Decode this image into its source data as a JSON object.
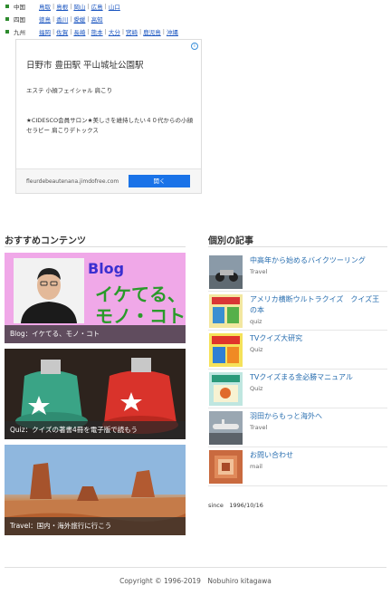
{
  "regions": [
    {
      "name": "中国",
      "links": [
        "鳥取",
        "島根",
        "岡山",
        "広島",
        "山口"
      ]
    },
    {
      "name": "四国",
      "links": [
        "徳島",
        "香川",
        "愛媛",
        "高知"
      ]
    },
    {
      "name": "九州",
      "links": [
        "福岡",
        "佐賀",
        "長崎",
        "熊本",
        "大分",
        "宮崎",
        "鹿児島",
        "沖縄"
      ]
    }
  ],
  "ad": {
    "info_glyph": "i",
    "title": "日野市 豊田駅 平山城址公園駅",
    "subtitle": "エステ 小顔フェイシャル 肩こり",
    "description": "★CIDESCO会員サロン★美しさを維持したい４０代からの小顔セラピー 肩こりデトックス",
    "url": "fleurdebeautenana.jimdofree.com",
    "button_label": "開く"
  },
  "recommended": {
    "heading": "おすすめコンテンツ",
    "cards": [
      {
        "caption": "Blog：イケてる、モノ・コト",
        "logo_word": "Blog",
        "logo_line1": "イケてる、",
        "logo_line2": "モノ・コト"
      },
      {
        "caption": "Quiz：クイズの著書4冊を電子版で読もう"
      },
      {
        "caption": "Travel：国内・海外旅行に行こう"
      }
    ]
  },
  "articles": {
    "heading": "個別の記事",
    "items": [
      {
        "title": "中高年から始めるバイクツーリング",
        "category": "Travel"
      },
      {
        "title": "アメリカ横断ウルトラクイズ　クイズ王の本",
        "category": "quiz"
      },
      {
        "title": "TVクイズ大研究",
        "category": "Quiz"
      },
      {
        "title": "TVクイズまる金必勝マニュアル",
        "category": "Quiz"
      },
      {
        "title": "羽田からもっと海外へ",
        "category": "Travel"
      },
      {
        "title": "お問い合わせ",
        "category": "mail"
      }
    ]
  },
  "since": "since　1996/10/16",
  "copyright": "Copyright © 1996-2019　Nobuhiro kitagawa",
  "colors": {
    "link": "#1a55c0",
    "article_link": "#2a6fb0",
    "ad_button": "#1a73e8",
    "region_bullet": "#2e8b2e"
  }
}
